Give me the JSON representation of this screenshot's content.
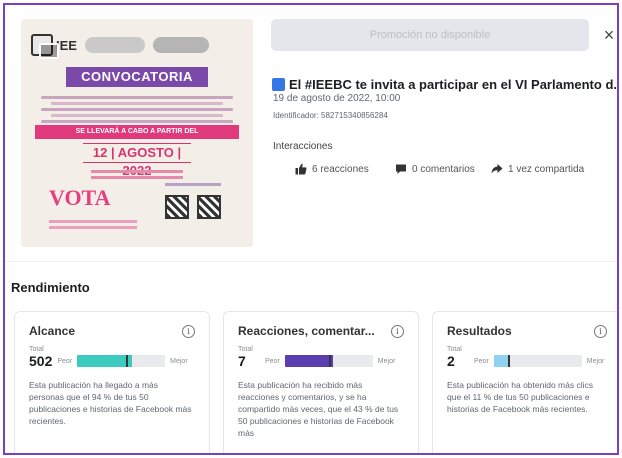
{
  "post": {
    "image": {
      "logo_text": "IEE",
      "convocatoria": "CONVOCATORIA",
      "banner": "SE LLEVARÁ A CABO A PARTIR DEL",
      "date": "12 | AGOSTO | 2022",
      "vote_text": "VOTA"
    },
    "promotion_label": "Promoción no disponible",
    "close_glyph": "×",
    "title": "El #IEEBC te invita a participar en el VI Parlamento d...",
    "date": "19 de agosto de 2022, 10:00",
    "identifier": "Identificador: 582715340856284",
    "interactions_label": "Interacciones",
    "interactions": {
      "reactions": "6 reacciones",
      "comments": "0 comentarios",
      "shares": "1 vez compartida"
    }
  },
  "performance": {
    "title": "Rendimiento",
    "total_label": "Total",
    "worse_label": "Peor",
    "better_label": "Mejor",
    "cards": [
      {
        "title": "Alcance",
        "value": "502",
        "bar_fill": 0.62,
        "bar_mark": 0.55,
        "color": "#3ccbbf",
        "description": "Esta publicación ha llegado a más personas que el 94 % de tus 50 publicaciones e historias de Facebook más recientes."
      },
      {
        "title": "Reacciones, comentar...",
        "value": "7",
        "bar_fill": 0.55,
        "bar_mark": 0.5,
        "color": "#5b3fb0",
        "description": "Esta publicación ha recibido más reacciones y comentarios, y se ha compartido más veces, que el 43 % de tus 50 publicaciones e historias de Facebook más"
      },
      {
        "title": "Resultados",
        "value": "2",
        "bar_fill": 0.18,
        "bar_mark": 0.16,
        "color": "#8fd3f0",
        "description": "Esta publicación ha obtenido más clics que el 11 % de tus 50 publicaciones e historias de Facebook más recientes."
      }
    ]
  }
}
